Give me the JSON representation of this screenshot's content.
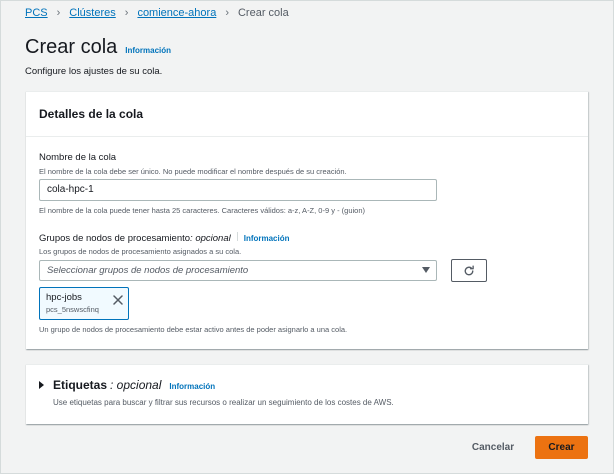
{
  "breadcrumb": {
    "items": [
      "PCS",
      "Clústeres",
      "comience-ahora"
    ],
    "current": "Crear cola"
  },
  "header": {
    "title": "Crear cola",
    "info_label": "Información",
    "description": "Configure los ajustes de su cola."
  },
  "details_panel": {
    "title": "Detalles de la cola",
    "name_field": {
      "label": "Nombre de la cola",
      "description": "El nombre de la cola debe ser único. No puede modificar el nombre después de su creación.",
      "value": "cola-hpc-1",
      "constraint": "El nombre de la cola puede tener hasta 25 caracteres. Caracteres válidos: a-z, A-Z, 0-9 y - (guion)"
    },
    "groups_field": {
      "label": "Grupos de nodos de procesamiento",
      "optional": " : opcional",
      "info_label": "Información",
      "description": "Los grupos de nodos de procesamiento asignados a su cola.",
      "placeholder": "Seleccionar grupos de nodos de procesamiento",
      "token_name": "hpc-jobs",
      "token_id": "pcs_5nswscfinq",
      "note": "Un grupo de nodos de procesamiento debe estar activo antes de poder asignarlo a una cola."
    }
  },
  "tags_panel": {
    "title": "Etiquetas",
    "optional": " : opcional",
    "info_label": "Información",
    "description": "Use etiquetas para buscar y filtrar sus recursos o realizar un seguimiento de los costes de AWS."
  },
  "actions": {
    "cancel_label": "Cancelar",
    "create_label": "Crear"
  },
  "colors": {
    "link": "#0073bb",
    "primary_button": "#ec7211",
    "background": "#f2f3f3"
  },
  "icons": [
    "chevron-right-icon",
    "chevron-down-icon",
    "refresh-icon",
    "close-icon",
    "caret-right-icon"
  ]
}
